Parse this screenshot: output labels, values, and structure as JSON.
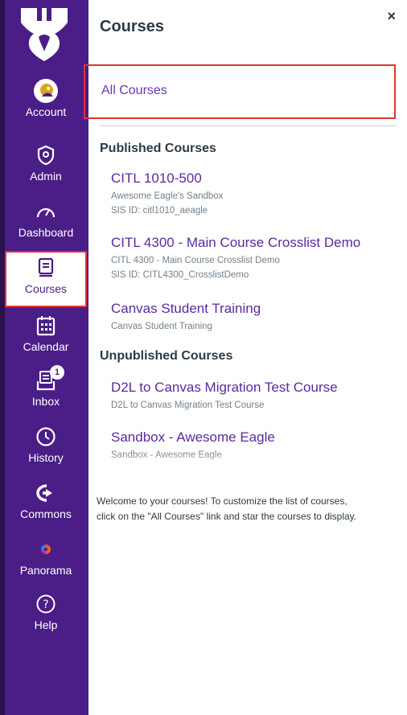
{
  "nav": {
    "items": [
      {
        "label": "Account",
        "icon": "account-avatar-icon"
      },
      {
        "label": "Admin",
        "icon": "shield-icon"
      },
      {
        "label": "Dashboard",
        "icon": "speedometer-icon"
      },
      {
        "label": "Courses",
        "icon": "book-icon"
      },
      {
        "label": "Calendar",
        "icon": "calendar-icon"
      },
      {
        "label": "Inbox",
        "icon": "inbox-icon",
        "badge": "1"
      },
      {
        "label": "History",
        "icon": "clock-icon"
      },
      {
        "label": "Commons",
        "icon": "commons-arrow-icon"
      },
      {
        "label": "Panorama",
        "icon": "panorama-icon"
      },
      {
        "label": "Help",
        "icon": "help-icon"
      }
    ],
    "colors": {
      "background": "#4b1d87",
      "active_border": "#e2342f"
    }
  },
  "tray": {
    "title": "Courses",
    "close_label": "×",
    "all_courses": "All Courses",
    "published_heading": "Published Courses",
    "published": [
      {
        "title": "CITL 1010-500",
        "term": "Awesome Eagle's Sandbox",
        "sis": "SIS ID: citl1010_aeagle"
      },
      {
        "title": "CITL 4300 - Main Course Crosslist Demo",
        "term": "CITL 4300 - Main Course Crosslist Demo",
        "sis": "SIS ID: CITL4300_CrosslistDemo"
      },
      {
        "title": "Canvas Student Training",
        "term": "Canvas Student Training"
      }
    ],
    "unpublished_heading": "Unpublished Courses",
    "unpublished": [
      {
        "title": "D2L to Canvas Migration Test Course",
        "term": "D2L to Canvas Migration Test Course"
      },
      {
        "title": "Sandbox - Awesome Eagle",
        "term": "Sandbox - Awesome Eagle"
      }
    ],
    "help_text": "Welcome to your courses! To customize the list of courses, click on the \"All Courses\" link and star the courses to display.",
    "colors": {
      "link": "#6b34b5",
      "heading": "#2d3b45",
      "muted": "#73818c"
    }
  }
}
